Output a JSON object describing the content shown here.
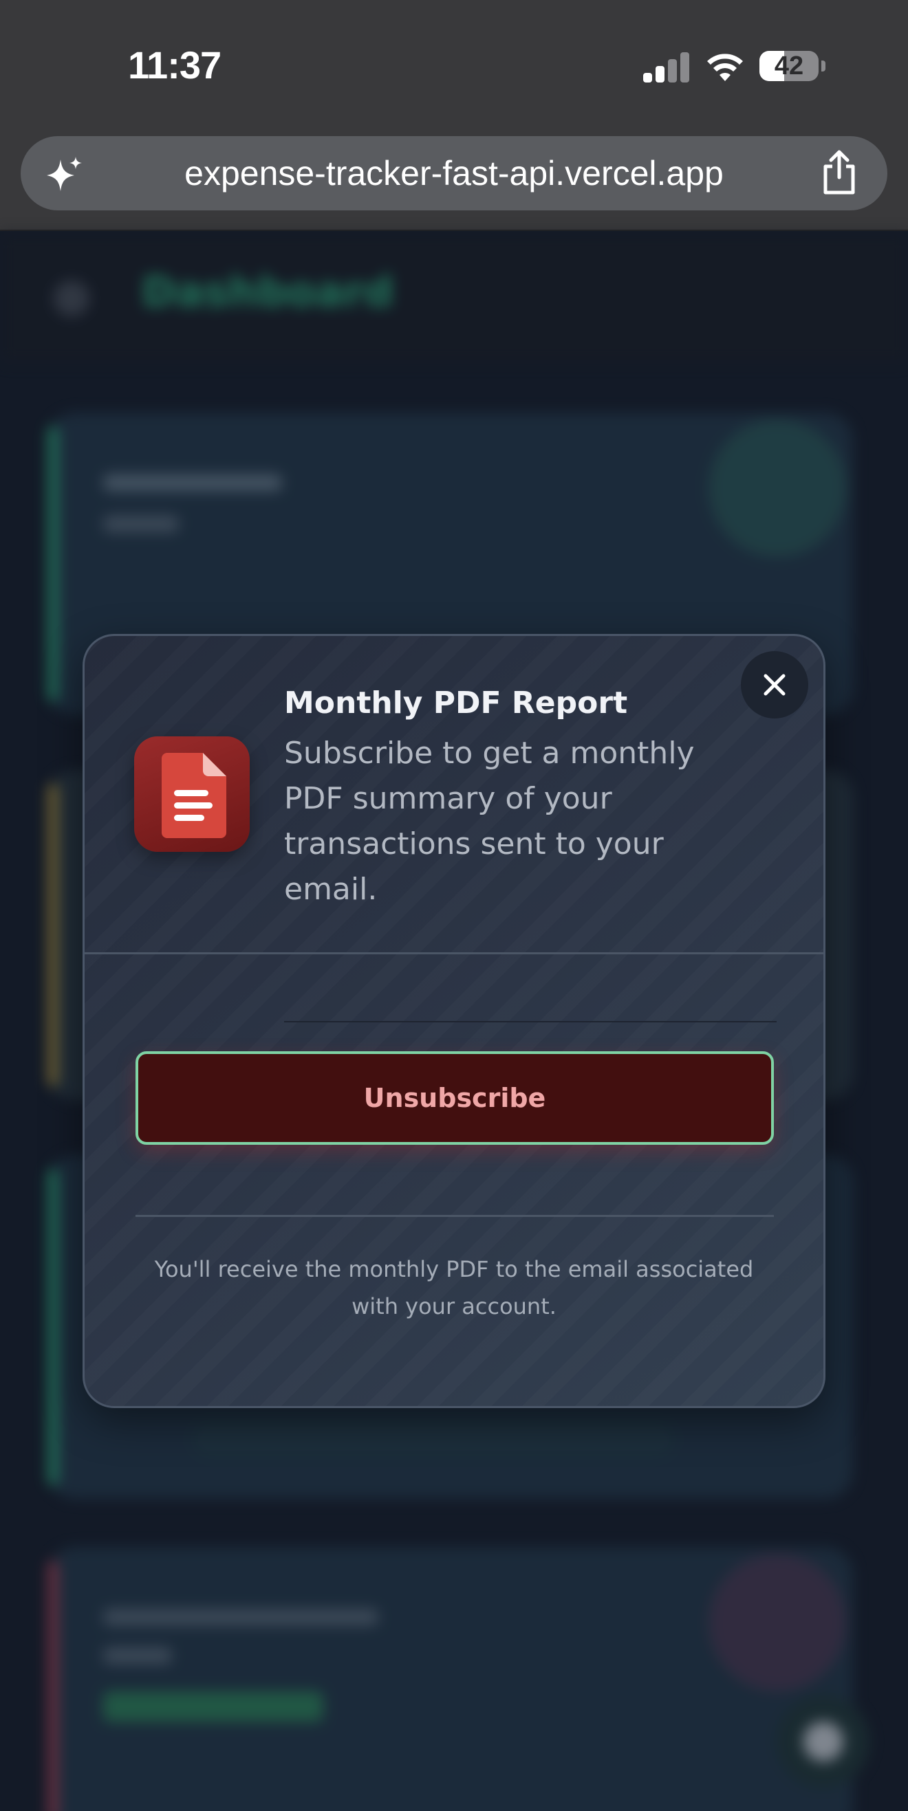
{
  "status_bar": {
    "time": "11:37",
    "battery_percent": "42",
    "battery_level": 0.42
  },
  "browser": {
    "url": "expense-tracker-fast-api.vercel.app",
    "left_icon": "sparkle-icon",
    "right_icon": "share-icon"
  },
  "background_page": {
    "header_title": "Dashboard"
  },
  "modal": {
    "title": "Monthly PDF Report",
    "description": "Subscribe to get a monthly PDF summary of your transactions sent to your email.",
    "unsubscribe_label": "Unsubscribe",
    "footnote": "You'll receive the monthly PDF to the email associated with your account.",
    "icon": "pdf-document-icon",
    "close_icon": "close-icon"
  },
  "colors": {
    "modal_bg": "#2c3546",
    "unsubscribe_bg": "#420f0f",
    "unsubscribe_border": "#7fd3a4",
    "unsubscribe_text": "#f0a7a7",
    "pdf_icon_red": "#d6473d",
    "dashboard_accent": "#2fbf87"
  }
}
